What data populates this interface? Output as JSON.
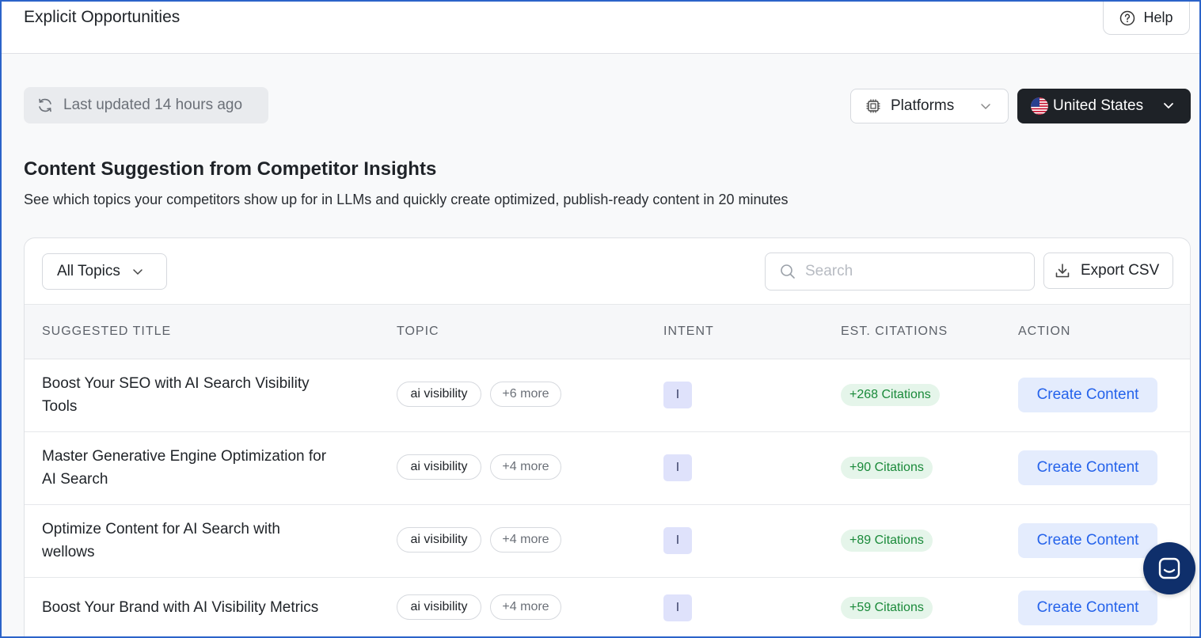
{
  "header": {
    "title": "Explicit Opportunities",
    "help_label": "Help"
  },
  "toolbar": {
    "last_updated": "Last updated 14 hours ago",
    "platforms_label": "Platforms",
    "country_label": "United States"
  },
  "section": {
    "title": "Content Suggestion from Competitor Insights",
    "subtitle": "See which topics your competitors show up for in LLMs and quickly create optimized, publish-ready content in 20 minutes"
  },
  "table_controls": {
    "topics_filter": "All Topics",
    "search_placeholder": "Search",
    "export_label": "Export CSV"
  },
  "table": {
    "headers": [
      "SUGGESTED TITLE",
      "TOPIC",
      "INTENT",
      "EST. CITATIONS",
      "ACTION"
    ],
    "rows": [
      {
        "title_line1": "Boost Your SEO with AI Search Visibility",
        "title_line2": "Tools",
        "topic": "ai visibility",
        "more": "+6 more",
        "intent": "I",
        "citations": "+268 Citations",
        "action": "Create Content"
      },
      {
        "title_line1": "Master Generative Engine Optimization for",
        "title_line2": "AI Search",
        "topic": "ai visibility",
        "more": "+4 more",
        "intent": "I",
        "citations": "+90 Citations",
        "action": "Create Content"
      },
      {
        "title_line1": "Optimize Content for AI Search with",
        "title_line2": "wellows",
        "topic": "ai visibility",
        "more": "+4 more",
        "intent": "I",
        "citations": "+89 Citations",
        "action": "Create Content"
      },
      {
        "title_line1": "Boost Your Brand with AI Visibility Metrics",
        "title_line2": "",
        "topic": "ai visibility",
        "more": "+4 more",
        "intent": "I",
        "citations": "+59 Citations",
        "action": "Create Content"
      }
    ]
  },
  "colors": {
    "accent": "#2563eb",
    "dark_button": "#1e2227",
    "citation_green": "#1a8a3a",
    "intent_badge": "#dfe2fb",
    "chat_fab": "#0f2f6b"
  },
  "icons": [
    "help-circle-icon",
    "refresh-icon",
    "chip-icon",
    "chevron-down-icon",
    "us-flag-icon",
    "search-icon",
    "download-icon",
    "chat-icon"
  ]
}
